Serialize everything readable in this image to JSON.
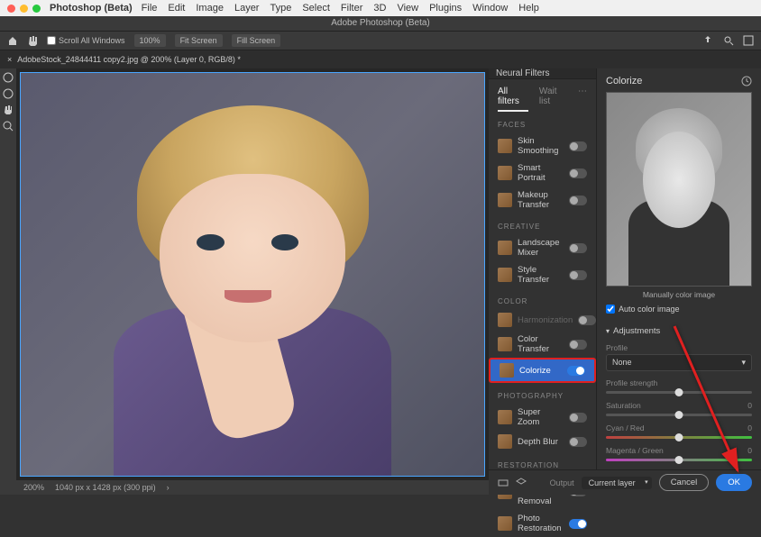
{
  "menubar": {
    "app": "Photoshop (Beta)",
    "items": [
      "File",
      "Edit",
      "Image",
      "Layer",
      "Type",
      "Select",
      "Filter",
      "3D",
      "View",
      "Plugins",
      "Window",
      "Help"
    ]
  },
  "titlebar": "Adobe Photoshop (Beta)",
  "optbar": {
    "scroll_all": "Scroll All Windows",
    "zoom": "100%",
    "fit": "Fit Screen",
    "fill": "Fill Screen"
  },
  "tab": {
    "name": "AdobeStock_24844411 copy2.jpg @ 200% (Layer 0, RGB/8) *",
    "close": "×"
  },
  "status": {
    "zoom": "200%",
    "info": "1040 px x 1428 px (300 ppi)"
  },
  "panel": {
    "title": "Neural Filters",
    "tabs": {
      "all": "All filters",
      "wait": "Wait list"
    },
    "sections": {
      "faces": {
        "label": "FACES",
        "items": [
          "Skin Smoothing",
          "Smart Portrait",
          "Makeup Transfer"
        ]
      },
      "creative": {
        "label": "CREATIVE",
        "items": [
          "Landscape Mixer",
          "Style Transfer"
        ]
      },
      "color": {
        "label": "COLOR",
        "items": [
          "Harmonization",
          "Color Transfer",
          "Colorize"
        ]
      },
      "photography": {
        "label": "PHOTOGRAPHY",
        "items": [
          "Super Zoom",
          "Depth Blur"
        ]
      },
      "restoration": {
        "label": "RESTORATION",
        "items": [
          "JPEG Artifacts Removal",
          "Photo Restoration"
        ]
      }
    }
  },
  "right": {
    "title": "Colorize",
    "caption": "Manually color image",
    "auto": "Auto color image",
    "adjustments": "Adjustments",
    "profile_label": "Profile",
    "profile_value": "None",
    "strength_label": "Profile strength",
    "saturation_label": "Saturation",
    "cyan_label": "Cyan / Red",
    "magenta_label": "Magenta / Green",
    "zero": "0"
  },
  "footer": {
    "output_label": "Output",
    "output_value": "Current layer",
    "cancel": "Cancel",
    "ok": "OK"
  }
}
